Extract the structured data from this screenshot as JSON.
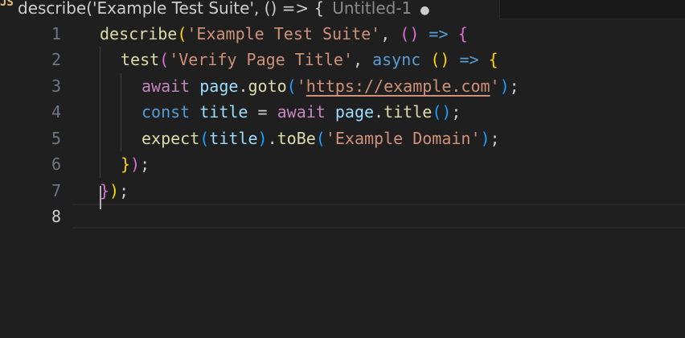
{
  "tab": {
    "title": "describe('Example Test Suite', () => {",
    "untitled": "Untitled-1",
    "close_glyph": "●"
  },
  "editor": {
    "line_numbers": [
      "1",
      "2",
      "3",
      "4",
      "5",
      "6",
      "7",
      "8"
    ],
    "active_line": "8",
    "lines": {
      "l1": {
        "describe": "describe",
        "open_paren": "(",
        "suite_name": "'Example Test Suite'",
        "comma": ", ",
        "arrow_parens": "()",
        "arrow": " => ",
        "open_brace": "{"
      },
      "l2": {
        "test": "test",
        "open_paren": "(",
        "test_name": "'Verify Page Title'",
        "comma": ", ",
        "async": "async",
        "space": " ",
        "arrow_parens": "()",
        "arrow": " => ",
        "open_brace": "{"
      },
      "l3": {
        "await": "await",
        "space": " ",
        "page": "page",
        "dot": ".",
        "goto": "goto",
        "open_paren": "(",
        "quote_open": "'",
        "url": "https://example.com",
        "quote_close": "'",
        "close_paren": ")",
        "semi": ";"
      },
      "l4": {
        "const": "const",
        "space1": " ",
        "title": "title",
        "equals": " = ",
        "await": "await",
        "space2": " ",
        "page": "page",
        "dot": ".",
        "title_fn": "title",
        "parens": "()",
        "semi": ";"
      },
      "l5": {
        "expect": "expect",
        "open_paren": "(",
        "title": "title",
        "close_paren": ")",
        "dot": ".",
        "tobe": "toBe",
        "open_paren2": "(",
        "expected": "'Example Domain'",
        "close_paren2": ")",
        "semi": ";"
      },
      "l6": {
        "close_brace": "}",
        "close_paren": ")",
        "semi": ";"
      },
      "l7": {
        "close_brace": "}",
        "close_paren": ")",
        "semi": ";"
      }
    }
  }
}
